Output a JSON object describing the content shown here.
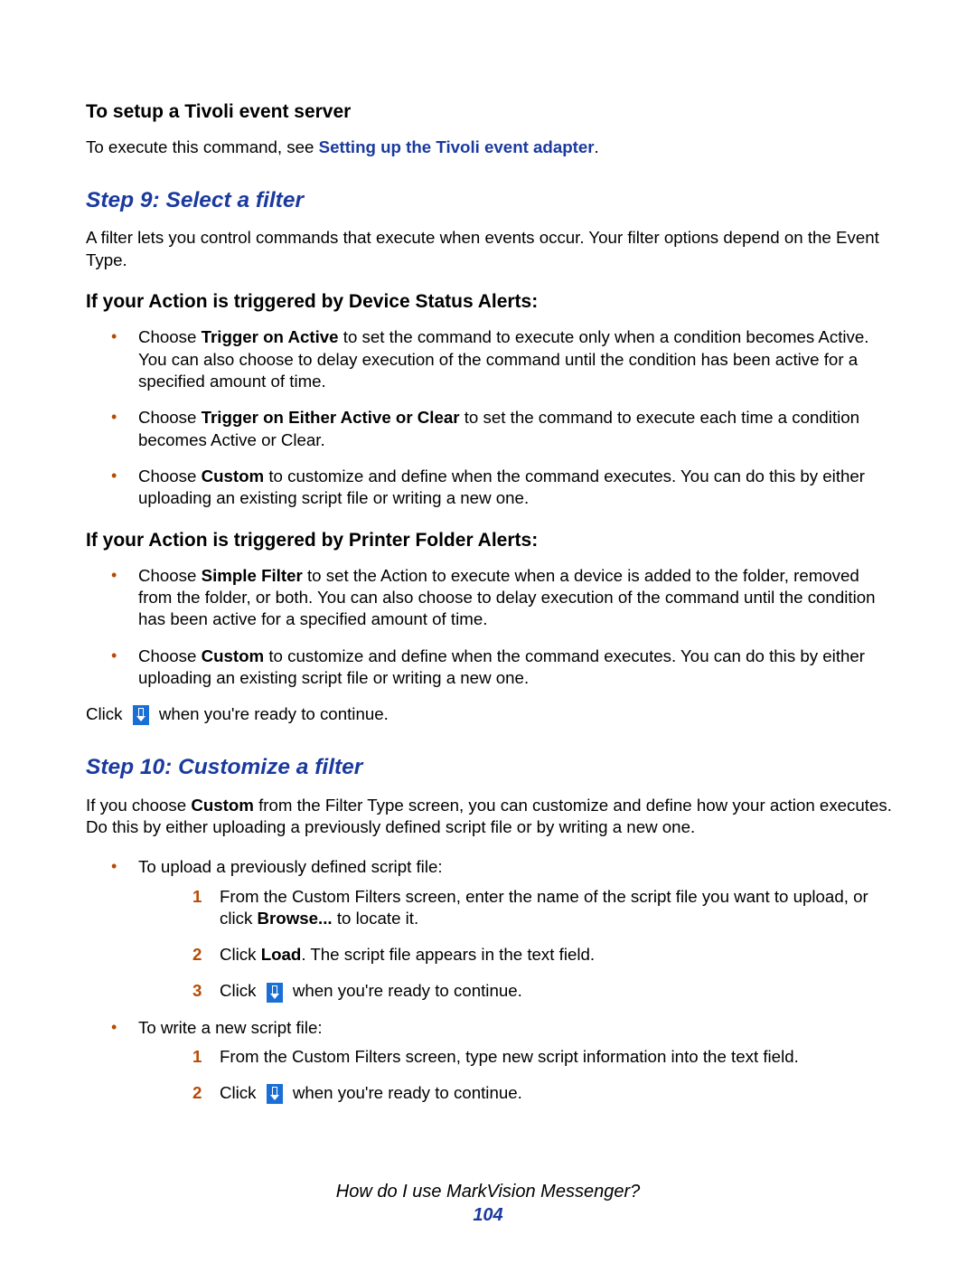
{
  "section1": {
    "title": "To setup a Tivoli event server",
    "body_a": "To execute this command, see ",
    "link": "Setting up the Tivoli event adapter",
    "body_b": "."
  },
  "step9": {
    "title": "Step 9: Select a filter",
    "intro": "A filter lets you control commands that execute when events occur. Your filter options depend on the Event Type.",
    "sub1_title": "If your Action is triggered by Device Status Alerts:",
    "sub1_items": [
      {
        "lead": "Choose ",
        "bold": "Trigger on Active",
        "rest": " to set the command to execute only when a condition becomes Active. You can also choose to delay execution of the command until the condition has been active for a specified amount of time."
      },
      {
        "lead": "Choose ",
        "bold": "Trigger on Either Active or Clear",
        "rest": " to set the command to execute each time a condition becomes Active or Clear."
      },
      {
        "lead": "Choose ",
        "bold": "Custom",
        "rest": " to customize and define when the command executes. You can do this by either uploading an existing script file or writing a new one."
      }
    ],
    "sub2_title": "If your Action is triggered by Printer Folder Alerts:",
    "sub2_items": [
      {
        "lead": "Choose ",
        "bold": "Simple Filter",
        "rest": " to set the Action to execute when a device is added to the folder, removed from the folder, or both. You can also choose to delay execution of the command until the condition has been active for a specified amount of time."
      },
      {
        "lead": "Choose ",
        "bold": "Custom",
        "rest": " to customize and define when the command executes. You can do this by either uploading an existing script file or writing a new one."
      }
    ],
    "click_a": "Click ",
    "click_b": " when you're ready to continue."
  },
  "step10": {
    "title": "Step 10: Customize a filter",
    "intro_a": "If you choose ",
    "intro_bold": "Custom",
    "intro_b": " from the Filter Type screen, you can customize and define how your action executes. Do this by either uploading a previously defined script file or by writing a new one.",
    "upload_label": "To upload a previously defined script file:",
    "upload_steps": [
      {
        "a": "From the Custom Filters screen, enter the name of the script file you want to upload, or click ",
        "bold": "Browse...",
        "b": " to locate it."
      },
      {
        "a": "Click ",
        "bold": "Load",
        "b": ". The script file appears in the text field."
      },
      {
        "a": "Click ",
        "icon": true,
        "b": " when you're ready to continue."
      }
    ],
    "write_label": "To write a new script file:",
    "write_steps": [
      {
        "a": "From the Custom Filters screen, type new script information into the text field."
      },
      {
        "a": "Click ",
        "icon": true,
        "b": " when you're ready to continue."
      }
    ]
  },
  "footer": {
    "title": "How do I use MarkVision Messenger?",
    "page": "104"
  }
}
